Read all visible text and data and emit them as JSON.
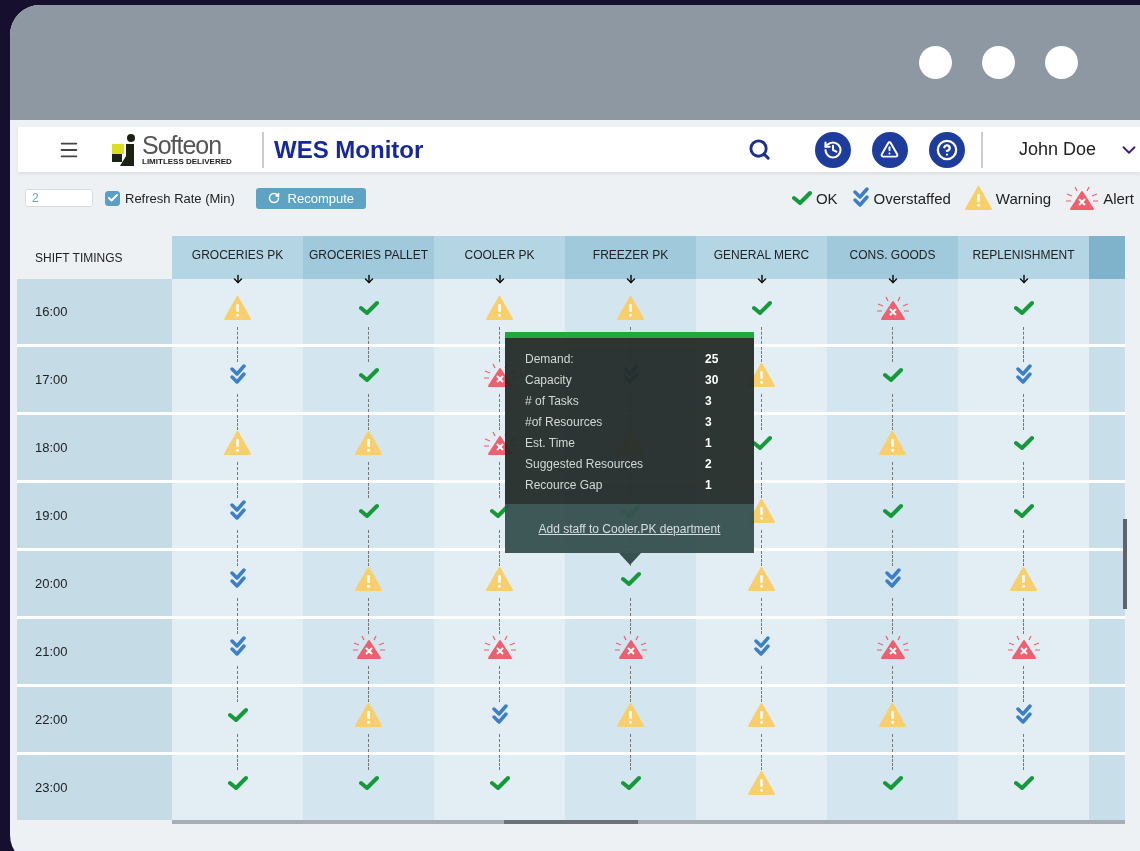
{
  "header": {
    "logo_text": "Softeon",
    "logo_tagline": "LIMITLESS DELIVERED",
    "title": "WES Monitor",
    "user": "John Doe"
  },
  "toolbar": {
    "refresh_value": "2",
    "refresh_checked": true,
    "refresh_label": "Refresh Rate (Min)",
    "recompute_label": "Recompute"
  },
  "legend": [
    {
      "kind": "ok",
      "label": "OK"
    },
    {
      "kind": "overstaffed",
      "label": "Overstaffed"
    },
    {
      "kind": "warning",
      "label": "Warning"
    },
    {
      "kind": "alert",
      "label": "Alert"
    }
  ],
  "grid": {
    "corner": "SHIFT TIMINGS",
    "columns": [
      "GROCERIES PK",
      "GROCERIES PALLET",
      "COOLER PK",
      "FREEZER PK",
      "GENERAL MERC",
      "CONS. GOODS",
      "REPLENISHMENT"
    ],
    "rows": [
      {
        "time": "16:00",
        "cells": [
          {
            "kind": "warning"
          },
          {
            "kind": "ok"
          },
          {
            "kind": "warning"
          },
          {
            "kind": "warning"
          },
          {
            "kind": "ok"
          },
          {
            "kind": "alert"
          },
          {
            "kind": "ok"
          }
        ]
      },
      {
        "time": "17:00",
        "cells": [
          {
            "kind": "overstaffed"
          },
          {
            "kind": "ok"
          },
          {
            "kind": "alert"
          },
          {
            "kind": "overstaffed"
          },
          {
            "kind": "warning"
          },
          {
            "kind": "ok"
          },
          {
            "kind": "overstaffed"
          }
        ]
      },
      {
        "time": "18:00",
        "cells": [
          {
            "kind": "warning"
          },
          {
            "kind": "warning"
          },
          {
            "kind": "alert"
          },
          {
            "kind": "warning"
          },
          {
            "kind": "ok"
          },
          {
            "kind": "warning"
          },
          {
            "kind": "ok"
          }
        ]
      },
      {
        "time": "19:00",
        "cells": [
          {
            "kind": "overstaffed"
          },
          {
            "kind": "ok"
          },
          {
            "kind": "ok"
          },
          {
            "kind": "ok"
          },
          {
            "kind": "warning"
          },
          {
            "kind": "ok"
          },
          {
            "kind": "ok"
          }
        ]
      },
      {
        "time": "20:00",
        "cells": [
          {
            "kind": "overstaffed"
          },
          {
            "kind": "warning"
          },
          {
            "kind": "warning"
          },
          {
            "kind": "ok"
          },
          {
            "kind": "warning"
          },
          {
            "kind": "overstaffed"
          },
          {
            "kind": "warning"
          }
        ]
      },
      {
        "time": "21:00",
        "cells": [
          {
            "kind": "overstaffed"
          },
          {
            "kind": "alert"
          },
          {
            "kind": "alert"
          },
          {
            "kind": "alert"
          },
          {
            "kind": "overstaffed"
          },
          {
            "kind": "alert"
          },
          {
            "kind": "alert"
          }
        ]
      },
      {
        "time": "22:00",
        "cells": [
          {
            "kind": "ok"
          },
          {
            "kind": "warning"
          },
          {
            "kind": "overstaffed"
          },
          {
            "kind": "warning"
          },
          {
            "kind": "warning"
          },
          {
            "kind": "warning"
          },
          {
            "kind": "overstaffed"
          }
        ]
      },
      {
        "time": "23:00",
        "cells": [
          {
            "kind": "ok"
          },
          {
            "kind": "ok"
          },
          {
            "kind": "ok"
          },
          {
            "kind": "ok"
          },
          {
            "kind": "warning"
          },
          {
            "kind": "ok"
          },
          {
            "kind": "ok"
          }
        ]
      }
    ]
  },
  "tooltip": {
    "rows": [
      {
        "label": "Demand:",
        "value": "25"
      },
      {
        "label": "Capacity",
        "value": "30"
      },
      {
        "label": "# of Tasks",
        "value": "3"
      },
      {
        "label": "#of Resources",
        "value": "3"
      },
      {
        "label": "Est. Time",
        "value": "1"
      },
      {
        "label": "Suggested Resources",
        "value": "2"
      },
      {
        "label": "Recource Gap",
        "value": "1"
      }
    ],
    "link": "Add staff to Cooler.PK department"
  }
}
